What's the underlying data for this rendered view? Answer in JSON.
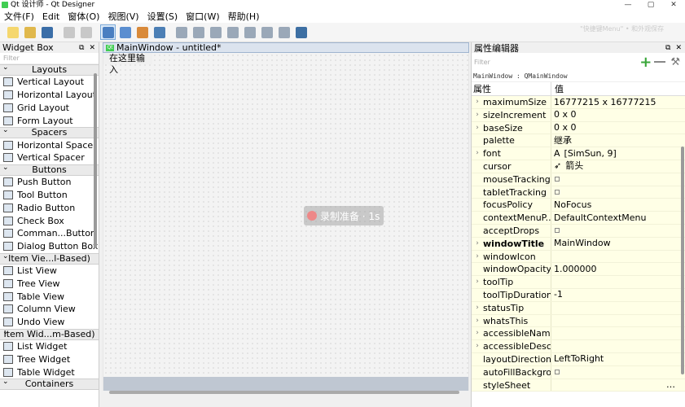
{
  "window": {
    "title": "Qt 设计师 - Qt Designer",
    "controls": [
      "—",
      "▢",
      "✕"
    ]
  },
  "menu": [
    "文件(F)",
    "Edit",
    "窗体(O)",
    "视图(V)",
    "设置(S)",
    "窗口(W)",
    "帮助(H)"
  ],
  "toolbar_icons": [
    {
      "name": "new-form-icon",
      "color": "#f5d76e"
    },
    {
      "name": "open-form-icon",
      "color": "#e0b84c"
    },
    {
      "name": "save-form-icon",
      "color": "#3b6ea8"
    },
    {
      "sep": true
    },
    {
      "name": "copy-icon",
      "color": "#c8c8c8"
    },
    {
      "name": "paste-icon",
      "color": "#c8c8c8"
    },
    {
      "sep": true
    },
    {
      "name": "edit-widgets-icon",
      "color": "#4a7fc1",
      "active": true
    },
    {
      "name": "edit-signals-icon",
      "color": "#5b8ed0"
    },
    {
      "name": "edit-buddies-icon",
      "color": "#d98a3a"
    },
    {
      "name": "edit-tab-order-icon",
      "color": "#4c7fb5"
    },
    {
      "sep": true
    },
    {
      "name": "layout-horizontal-icon",
      "color": "#9aa8b8"
    },
    {
      "name": "layout-vertical-icon",
      "color": "#9aa8b8"
    },
    {
      "name": "layout-h-splitter-icon",
      "color": "#9aa8b8"
    },
    {
      "name": "layout-v-splitter-icon",
      "color": "#9aa8b8"
    },
    {
      "name": "layout-grid-icon",
      "color": "#9aa8b8"
    },
    {
      "name": "layout-form-icon",
      "color": "#9aa8b8"
    },
    {
      "name": "break-layout-icon",
      "color": "#9aa8b8"
    },
    {
      "name": "adjust-size-icon",
      "color": "#3d6fa3"
    }
  ],
  "ghost_text": "\"快捷键Menu\" • 和外观保存",
  "widget_box": {
    "title": "Widget Box",
    "filter_placeholder": "Filter",
    "groups": [
      {
        "category": "Layouts",
        "items": [
          "Vertical Layout",
          "Horizontal Layout",
          "Grid Layout",
          "Form Layout"
        ]
      },
      {
        "category": "Spacers",
        "items": [
          "Horizontal Spacer",
          "Vertical Spacer"
        ]
      },
      {
        "category": "Buttons",
        "items": [
          "Push Button",
          "Tool Button",
          "Radio Button",
          "Check Box",
          "Comman...Button",
          "Dialog Button Box"
        ]
      },
      {
        "category": "Item Vie...l-Based)",
        "items": [
          "List View",
          "Tree View",
          "Table View",
          "Column View",
          "Undo View"
        ]
      },
      {
        "category": "Item Wid...m-Based)",
        "items": [
          "List Widget",
          "Tree Widget",
          "Table Widget"
        ]
      },
      {
        "category": "Containers",
        "items": []
      }
    ]
  },
  "form": {
    "mdi_title": "MainWindow - untitled*",
    "menu_placeholder": "在这里输入",
    "recording_badge": "录制准备 · 1s"
  },
  "property_editor": {
    "title": "属性编辑器",
    "filter_placeholder": "Filter",
    "object_line": "MainWindow : QMainWindow",
    "col_property": "属性",
    "col_value": "值",
    "rows": [
      {
        "name": "maximumSize",
        "value": "16777215 x 16777215",
        "expand": true
      },
      {
        "name": "sizeIncrement",
        "value": "0 x 0",
        "expand": true
      },
      {
        "name": "baseSize",
        "value": "0 x 0",
        "expand": true
      },
      {
        "name": "palette",
        "value": "继承"
      },
      {
        "name": "font",
        "value": "[SimSun, 9]",
        "expand": true,
        "icon": "A"
      },
      {
        "name": "cursor",
        "value": "箭头",
        "icon": "➶"
      },
      {
        "name": "mouseTracking",
        "value": "",
        "checkbox": true
      },
      {
        "name": "tabletTracking",
        "value": "",
        "checkbox": true
      },
      {
        "name": "focusPolicy",
        "value": "NoFocus"
      },
      {
        "name": "contextMenuP...",
        "value": "DefaultContextMenu"
      },
      {
        "name": "acceptDrops",
        "value": "",
        "checkbox": true
      },
      {
        "name": "windowTitle",
        "value": "MainWindow",
        "expand": true,
        "bold": true
      },
      {
        "name": "windowIcon",
        "value": "",
        "expand": true
      },
      {
        "name": "windowOpacity",
        "value": "1.000000"
      },
      {
        "name": "toolTip",
        "value": "",
        "expand": true
      },
      {
        "name": "toolTipDuration",
        "value": "-1"
      },
      {
        "name": "statusTip",
        "value": "",
        "expand": true
      },
      {
        "name": "whatsThis",
        "value": "",
        "expand": true
      },
      {
        "name": "accessibleName",
        "value": "",
        "expand": true
      },
      {
        "name": "accessibleDesc...",
        "value": "",
        "expand": true
      },
      {
        "name": "layoutDirection",
        "value": "LeftToRight"
      },
      {
        "name": "autoFillBackgro...",
        "value": "",
        "checkbox": true
      },
      {
        "name": "styleSheet",
        "value": "",
        "ellipsis": true
      }
    ]
  }
}
